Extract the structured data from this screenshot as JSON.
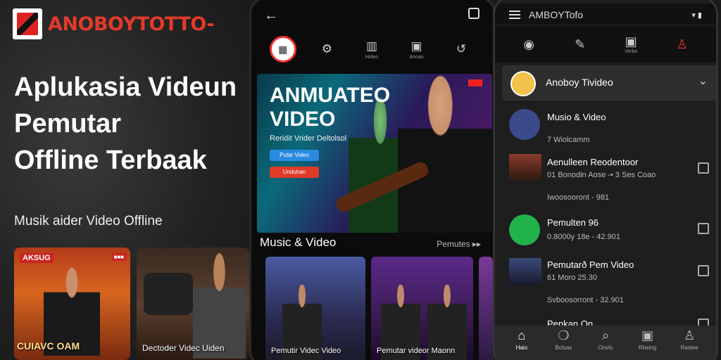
{
  "brand": {
    "name": "ANOBOYTOTTO-"
  },
  "promo": {
    "headline_1": "Aplukasia Videun",
    "headline_2": "Pemutar",
    "headline_3": "Offline Terbaak",
    "subhead": "Musik aider Video Offline",
    "cards": [
      {
        "tag": "AKSUG",
        "title": "CUIAVC OAM"
      },
      {
        "title": "Dectoder Videc Uiden"
      }
    ]
  },
  "phone1": {
    "icons": [
      "logo",
      "gear-icon",
      "music-icon",
      "video-icon",
      "refresh-icon"
    ],
    "icon_labels": [
      "",
      "",
      "Hideo",
      "Anoao",
      ""
    ],
    "hero": {
      "title_1": "ANMUATEO",
      "title_2": "VIDEO",
      "sub": "Reridit Vrider Deltolsol",
      "btn1": "Putar Video",
      "btn2": "Unduhan"
    },
    "section_title": "Music & Video",
    "section_more": "Pemutes ▸▸",
    "thumbs": [
      {
        "label": "Pemutir Videc Video"
      },
      {
        "label": "Pemutar videor Maonn"
      }
    ]
  },
  "phone2": {
    "title": "AMBOYTofo",
    "status_icons": "▾ ▮",
    "tabs": [
      "",
      "",
      "Verbo",
      ""
    ],
    "account": {
      "name": "Anoboy Tivideo"
    },
    "items": [
      {
        "title": "Musio & Video",
        "sub": "7 Wiolcamm"
      },
      {
        "title": "Aenulleen Reodentoor",
        "sub": "01 Bonodin Aose -• 3 Ses Coao",
        "meta": "Iwoosooront - 981"
      },
      {
        "title": "Pemulten 96",
        "sub": "0.8000y 18e - 42.901"
      },
      {
        "title": "Pemutarð Pem Video",
        "sub": "61 Moro 25.30",
        "meta": "Svboosorront - 32.901"
      },
      {
        "title": "Penkan On"
      }
    ],
    "bottom_nav": [
      {
        "icon": "home-icon",
        "label": "Haio"
      },
      {
        "icon": "chat-icon",
        "label": "Bolsas"
      },
      {
        "icon": "search-icon",
        "label": "Onvlo"
      },
      {
        "icon": "library-icon",
        "label": "Rbeing"
      },
      {
        "icon": "profile-icon",
        "label": "Rastee"
      }
    ]
  }
}
